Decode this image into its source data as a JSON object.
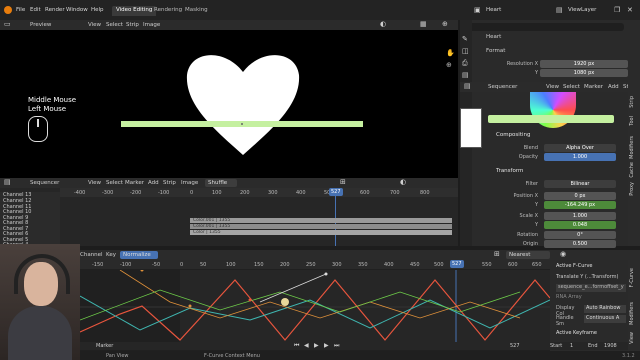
{
  "menus": [
    "File",
    "Edit",
    "Render",
    "Window",
    "Help"
  ],
  "workspaces": [
    "Video Editing",
    "Rendering",
    "Masking"
  ],
  "scene_name": "Heart",
  "view_layer": "ViewLayer",
  "preview": {
    "header_label": "Preview",
    "menus": [
      "View",
      "Select",
      "Strip",
      "Image"
    ],
    "overlay_lines": [
      "Middle Mouse",
      "Left Mouse"
    ]
  },
  "sequencer": {
    "header_label": "Sequencer",
    "menus": [
      "View",
      "Select",
      "Marker",
      "Add",
      "Strip",
      "Image"
    ],
    "shuffle": "Shuffle",
    "channels": [
      "Channel 13",
      "Channel 12",
      "Channel 11",
      "Channel 10",
      "Channel 9",
      "Channel 8",
      "Channel 7",
      "Channel 6",
      "Channel 5",
      "Channel 4"
    ],
    "ruler": [
      "-400",
      "-300",
      "-200",
      "-100",
      "0",
      "100",
      "200",
      "300",
      "400",
      "500",
      "600",
      "700",
      "800"
    ],
    "current_frame": "527",
    "strips": [
      "Color.001 | 1355",
      "Color.001 | 1355",
      "Color | 1355"
    ]
  },
  "properties": {
    "tab": "Heart",
    "format_label": "Format",
    "res_x_label": "Resolution X",
    "res_x": "1920 px",
    "res_y_label": "Y",
    "res_y": "1080 px",
    "header_label": "Sequencer",
    "menus": [
      "View",
      "Select",
      "Marker",
      "Add",
      "Strip"
    ],
    "compositing_label": "Compositing",
    "blend_label": "Blend",
    "blend": "Alpha Over",
    "opacity_label": "Opacity",
    "opacity": "1.000",
    "transform_label": "Transform",
    "filter_label": "Filter",
    "filter": "Bilinear",
    "pos_x_label": "Position X",
    "pos_x": "0 px",
    "pos_y_label": "Y",
    "pos_y": "-164.249 px",
    "scale_x_label": "Scale X",
    "scale_x": "1.000",
    "scale_y_label": "Y",
    "scale_y": "0.048",
    "rotation_label": "Rotation",
    "rotation": "0°",
    "origin_label": "Origin",
    "origin": "0.500",
    "side_tabs": [
      "Strip",
      "Tool",
      "Modifiers",
      "Cache",
      "Proxy"
    ]
  },
  "graph": {
    "menus": [
      "Channel",
      "Key"
    ],
    "normalize": "Normalize",
    "nearest_frame": "Nearest Frame",
    "ruler": [
      "-150",
      "-100",
      "-50",
      "0",
      "50",
      "100",
      "150",
      "200",
      "250",
      "300",
      "350",
      "400",
      "450",
      "500",
      "550",
      "600",
      "650"
    ],
    "current_frame": "527",
    "y_labels": [
      "1.0",
      "0.5",
      "0.0",
      "-0.5",
      "-1.0"
    ],
    "active_fcurve_label": "Active F-Curve",
    "fcurve_name": "Translate Y (...Transform)",
    "fcurve_path": "sequence_e...formoffset_y",
    "rna_array": "RNA Array",
    "display_color_label": "Display Col",
    "display_color": "Auto Rainbow",
    "handle_smooth_label": "Handle Sm",
    "handle_smooth": "Continuous A",
    "active_keyframe_label": "Active Keyframe",
    "side_tabs": [
      "F-Curve",
      "Modifiers",
      "View"
    ],
    "marker": "Marker",
    "playback_frame": "527",
    "start_label": "Start",
    "start": "1",
    "end_label": "End",
    "end": "1908"
  },
  "status": {
    "left": "Pan View",
    "mid": "F-Curve Context Menu",
    "right": "3.1.2"
  },
  "colors": {
    "accent_blue": "#4772b3",
    "strip_green": "#c5f0a0",
    "curve_red": "#e8553d",
    "curve_green": "#6fcf4a",
    "curve_cyan": "#3fb6b0",
    "curve_orange": "#e0913a"
  }
}
